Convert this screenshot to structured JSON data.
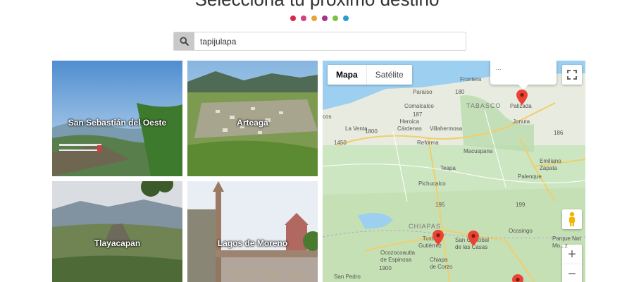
{
  "header": {
    "title": "Selecciona tu próximo destino",
    "dot_colors": [
      "#e0234b",
      "#d43f82",
      "#e8a33a",
      "#a6318f",
      "#7bc142",
      "#2e9bd3"
    ]
  },
  "search": {
    "value": "tapijulapa",
    "icon": "search-icon"
  },
  "destinations": [
    {
      "name": "San Sebastián del Oeste"
    },
    {
      "name": "Arteaga"
    },
    {
      "name": "Tlayacapan"
    },
    {
      "name": "Lagos de Moreno"
    }
  ],
  "map": {
    "map_type_options": [
      "Mapa",
      "Satélite"
    ],
    "selected_map_type": "Mapa",
    "info_window_text": "...",
    "fullscreen_icon": "fullscreen-icon",
    "zoom_in_label": "+",
    "zoom_out_label": "−",
    "pegman_icon": "pegman-icon",
    "marker_color": "#ea4335",
    "labels": {
      "frontera": "Frontera",
      "tabasco": "TABASCO",
      "palizada": "Palizada",
      "paraiso": "Paraíso",
      "comalcalco": "Comalcalco",
      "cos": "cos",
      "heroica_cardenas": "Heroica\nCárdenas",
      "la_venta": "La Venta",
      "villahermosa": "Villahermosa",
      "jonuta": "Jonuta",
      "reforma": "Reforma",
      "macuspana": "Macuspana",
      "teapa": "Teapa",
      "emiliano_zapata": "Emiliano\nZapata",
      "palenque": "Palenque",
      "pichucalco": "Pichucalco",
      "chiapas": "CHIAPAS",
      "tuxtla": "Tuxtla\nGutiérrez",
      "san_cristobal": "San Cristóbal\nde las Casas",
      "ocosingo": "Ocosingo",
      "parque_nat": "Parque Nat\nMo...z",
      "ocozocoautla": "Ocozocoautla\nde Espinosa",
      "chiapa_de_corzo": "Chiapa\nde Corzo",
      "san_pedro": "San Pedro",
      "r180": "180",
      "r187": "187",
      "r186": "186",
      "r1450": "1450",
      "r1800": "1800",
      "r195": "195",
      "r199": "199",
      "r1900": "1900"
    }
  }
}
